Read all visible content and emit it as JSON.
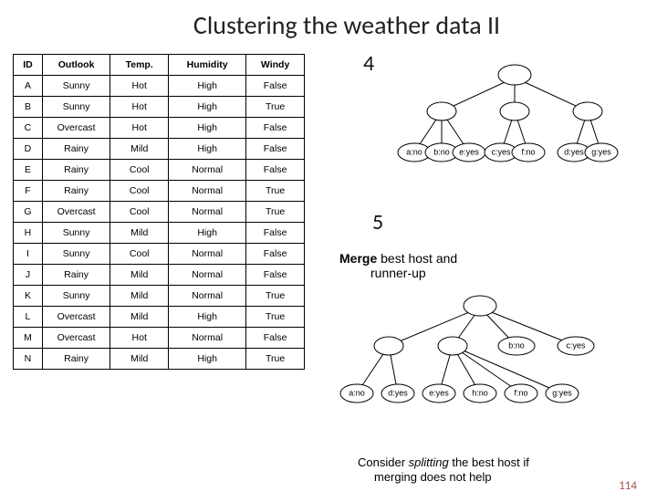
{
  "title": "Clustering the weather data II",
  "page_number": "114",
  "table": {
    "headers": [
      "ID",
      "Outlook",
      "Temp.",
      "Humidity",
      "Windy"
    ],
    "rows": [
      [
        "A",
        "Sunny",
        "Hot",
        "High",
        "False"
      ],
      [
        "B",
        "Sunny",
        "Hot",
        "High",
        "True"
      ],
      [
        "C",
        "Overcast",
        "Hot",
        "High",
        "False"
      ],
      [
        "D",
        "Rainy",
        "Mild",
        "High",
        "False"
      ],
      [
        "E",
        "Rainy",
        "Cool",
        "Normal",
        "False"
      ],
      [
        "F",
        "Rainy",
        "Cool",
        "Normal",
        "True"
      ],
      [
        "G",
        "Overcast",
        "Cool",
        "Normal",
        "True"
      ],
      [
        "H",
        "Sunny",
        "Mild",
        "High",
        "False"
      ],
      [
        "I",
        "Sunny",
        "Cool",
        "Normal",
        "False"
      ],
      [
        "J",
        "Rainy",
        "Mild",
        "Normal",
        "False"
      ],
      [
        "K",
        "Sunny",
        "Mild",
        "Normal",
        "True"
      ],
      [
        "L",
        "Overcast",
        "Mild",
        "High",
        "True"
      ],
      [
        "M",
        "Overcast",
        "Hot",
        "Normal",
        "False"
      ],
      [
        "N",
        "Rainy",
        "Mild",
        "High",
        "True"
      ]
    ]
  },
  "step4": {
    "num": "4"
  },
  "step5": {
    "num": "5"
  },
  "merge": {
    "bold": "Merge",
    "rest": " best host and",
    "line2": "runner-up"
  },
  "consider": {
    "pre": "Consider ",
    "italic": "splitting",
    "rest": " the best host if",
    "line2": "merging does not help"
  },
  "tree4_nodes": {
    "root": "",
    "l2": [
      "",
      "",
      ""
    ],
    "leaves": [
      "a:no",
      "b:no",
      "e:yes",
      "c:yes",
      "f:no",
      "d:yes",
      "g:yes"
    ]
  },
  "tree5_nodes": {
    "root": "",
    "l2": [
      "",
      "",
      "b:no",
      "c:yes"
    ],
    "leaves": [
      "a:no",
      "d:yes",
      "e:yes",
      "h:no",
      "f:no",
      "g:yes"
    ]
  }
}
